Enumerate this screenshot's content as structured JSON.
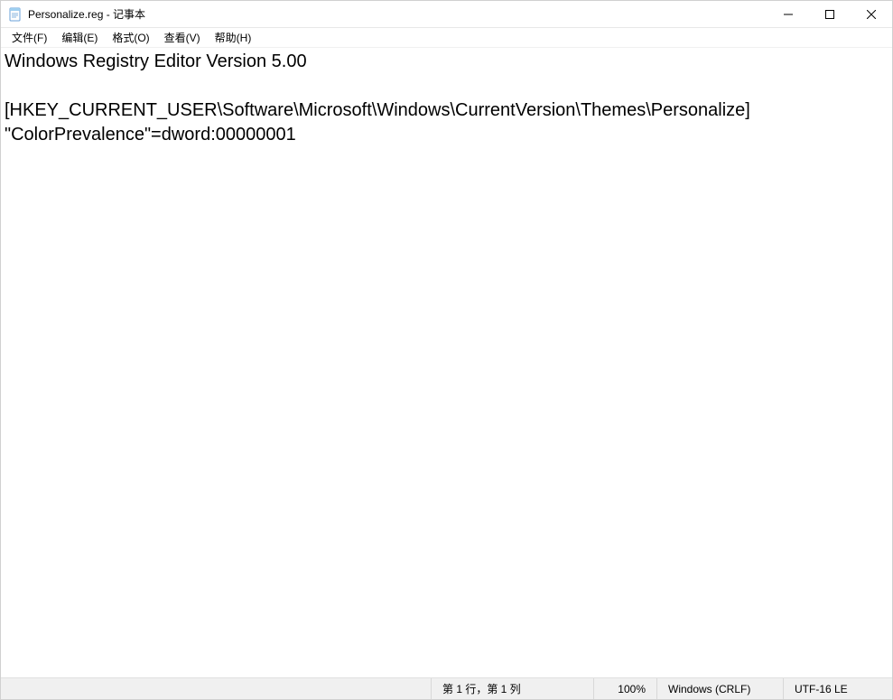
{
  "titlebar": {
    "title": "Personalize.reg - 记事本"
  },
  "menu": {
    "file": "文件(F)",
    "edit": "编辑(E)",
    "format": "格式(O)",
    "view": "查看(V)",
    "help": "帮助(H)"
  },
  "document": {
    "content": "Windows Registry Editor Version 5.00\n\n[HKEY_CURRENT_USER\\Software\\Microsoft\\Windows\\CurrentVersion\\Themes\\Personalize]\n\"ColorPrevalence\"=dword:00000001"
  },
  "status": {
    "position": "第 1 行，第 1 列",
    "zoom": "100%",
    "eol": "Windows (CRLF)",
    "encoding": "UTF-16 LE"
  }
}
